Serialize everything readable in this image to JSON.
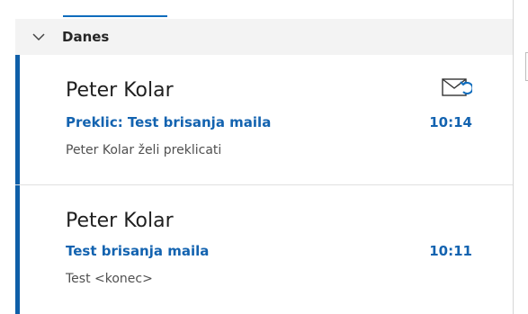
{
  "group": {
    "label": "Danes"
  },
  "messages": [
    {
      "sender": "Peter Kolar",
      "subject": "Preklic: Test brisanja maila",
      "time": "10:14",
      "preview": "Peter Kolar želi preklicati",
      "icon": "recall-envelope-icon"
    },
    {
      "sender": "Peter Kolar",
      "subject": "Test brisanja maila",
      "time": "10:11",
      "preview": "Test <konec>"
    }
  ],
  "colors": {
    "accent": "#0f5fa8",
    "link": "#1363b0",
    "header_bg": "#f3f3f3"
  }
}
